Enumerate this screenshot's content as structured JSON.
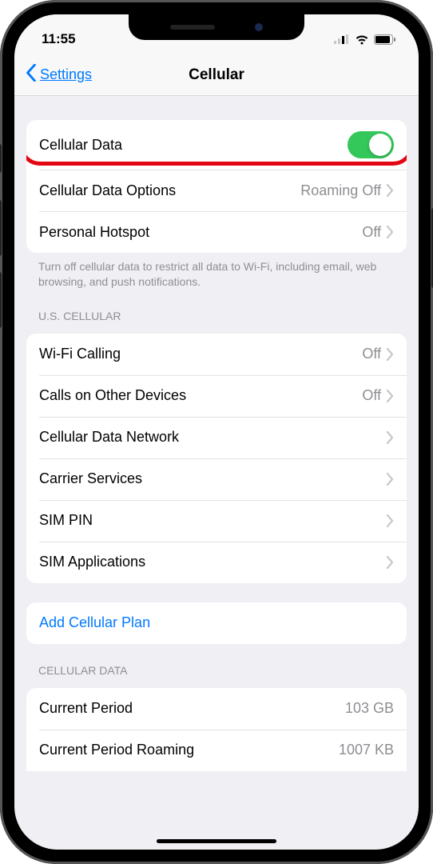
{
  "statusBar": {
    "time": "11:55"
  },
  "nav": {
    "back": "Settings",
    "title": "Cellular"
  },
  "section1": {
    "cellularData": "Cellular Data",
    "cellularDataOptions": "Cellular Data Options",
    "cellularDataOptionsValue": "Roaming Off",
    "personalHotspot": "Personal Hotspot",
    "personalHotspotValue": "Off",
    "footer": "Turn off cellular data to restrict all data to Wi-Fi, including email, web browsing, and push notifications."
  },
  "section2": {
    "header": "U.S. CELLULAR",
    "wifiCalling": "Wi-Fi Calling",
    "wifiCallingValue": "Off",
    "callsOther": "Calls on Other Devices",
    "callsOtherValue": "Off",
    "dataNetwork": "Cellular Data Network",
    "carrierServices": "Carrier Services",
    "simPin": "SIM PIN",
    "simApps": "SIM Applications"
  },
  "section3": {
    "addPlan": "Add Cellular Plan"
  },
  "section4": {
    "header": "CELLULAR DATA",
    "currentPeriod": "Current Period",
    "currentPeriodValue": "103 GB",
    "currentRoaming": "Current Period Roaming",
    "currentRoamingValue": "1007 KB"
  }
}
